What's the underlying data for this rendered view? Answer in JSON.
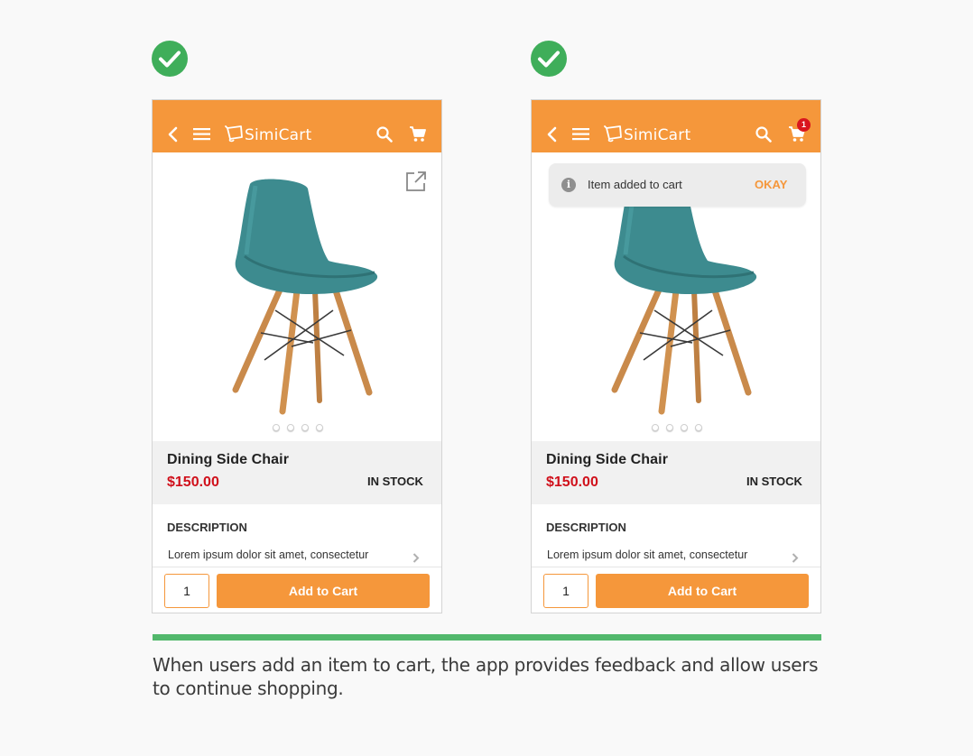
{
  "colors": {
    "brand_orange": "#f5973b",
    "check_green": "#3fae5a",
    "price_red": "#d0101b",
    "badge_red": "#d9161e",
    "toast_bg": "#ececec",
    "info_icon_gray": "#8f8f8f"
  },
  "screens": [
    {
      "app_name": "SimiCart",
      "cart_count": "",
      "toast": null,
      "product_name": "Dining Side Chair",
      "price": "$150.00",
      "stock_status": "IN STOCK",
      "description_heading": "DESCRIPTION",
      "description_text": "Lorem ipsum dolor sit amet, consectetur",
      "quantity": "1",
      "add_button": "Add to Cart",
      "image_slides": 4,
      "icons": [
        "back-icon",
        "menu-icon",
        "search-icon",
        "cart-icon",
        "share-icon",
        "chevron-right-icon"
      ]
    },
    {
      "app_name": "SimiCart",
      "cart_count": "1",
      "toast": {
        "message": "Item added to cart",
        "action": "OKAY",
        "icon": "info-icon"
      },
      "product_name": "Dining Side Chair",
      "price": "$150.00",
      "stock_status": "IN STOCK",
      "description_heading": "DESCRIPTION",
      "description_text": "Lorem ipsum dolor sit amet, consectetur",
      "quantity": "1",
      "add_button": "Add to Cart",
      "image_slides": 4,
      "icons": [
        "back-icon",
        "menu-icon",
        "search-icon",
        "cart-icon",
        "chevron-right-icon"
      ]
    }
  ],
  "caption": "When users add an item to cart, the app provides feedback and allow users to continue shopping."
}
